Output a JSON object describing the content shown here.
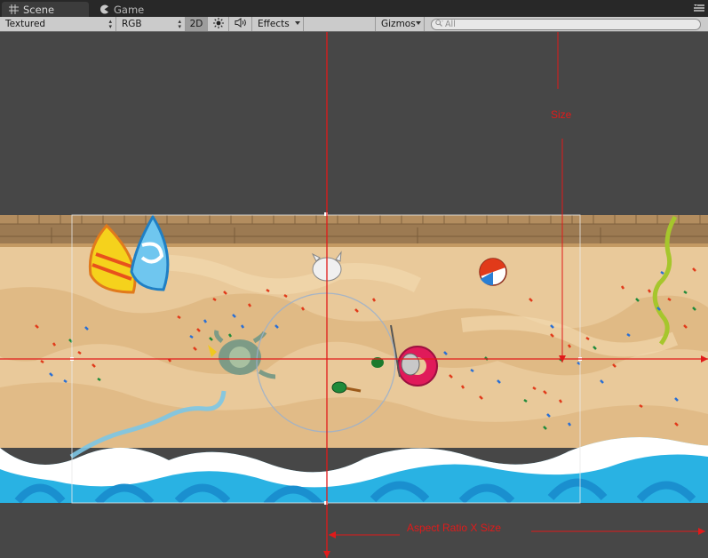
{
  "tabs": {
    "scene_label": "Scene",
    "game_label": "Game"
  },
  "toolbar": {
    "shading_mode": "Textured",
    "render_mode": "RGB",
    "mode_2d_label": "2D",
    "effects_label": "Effects",
    "gizmos_label": "Gizmos",
    "search_placeholder": "All"
  },
  "annotations": {
    "size_label": "Size",
    "aspect_label": "Aspect Ratio X Size"
  },
  "colors": {
    "annotation_red": "#e11a1a",
    "sand": "#e9c99a",
    "sand_dark": "#d9ad74",
    "water": "#29b2e3",
    "foam": "#ffffff",
    "boardwalk": "#9c7a52"
  }
}
